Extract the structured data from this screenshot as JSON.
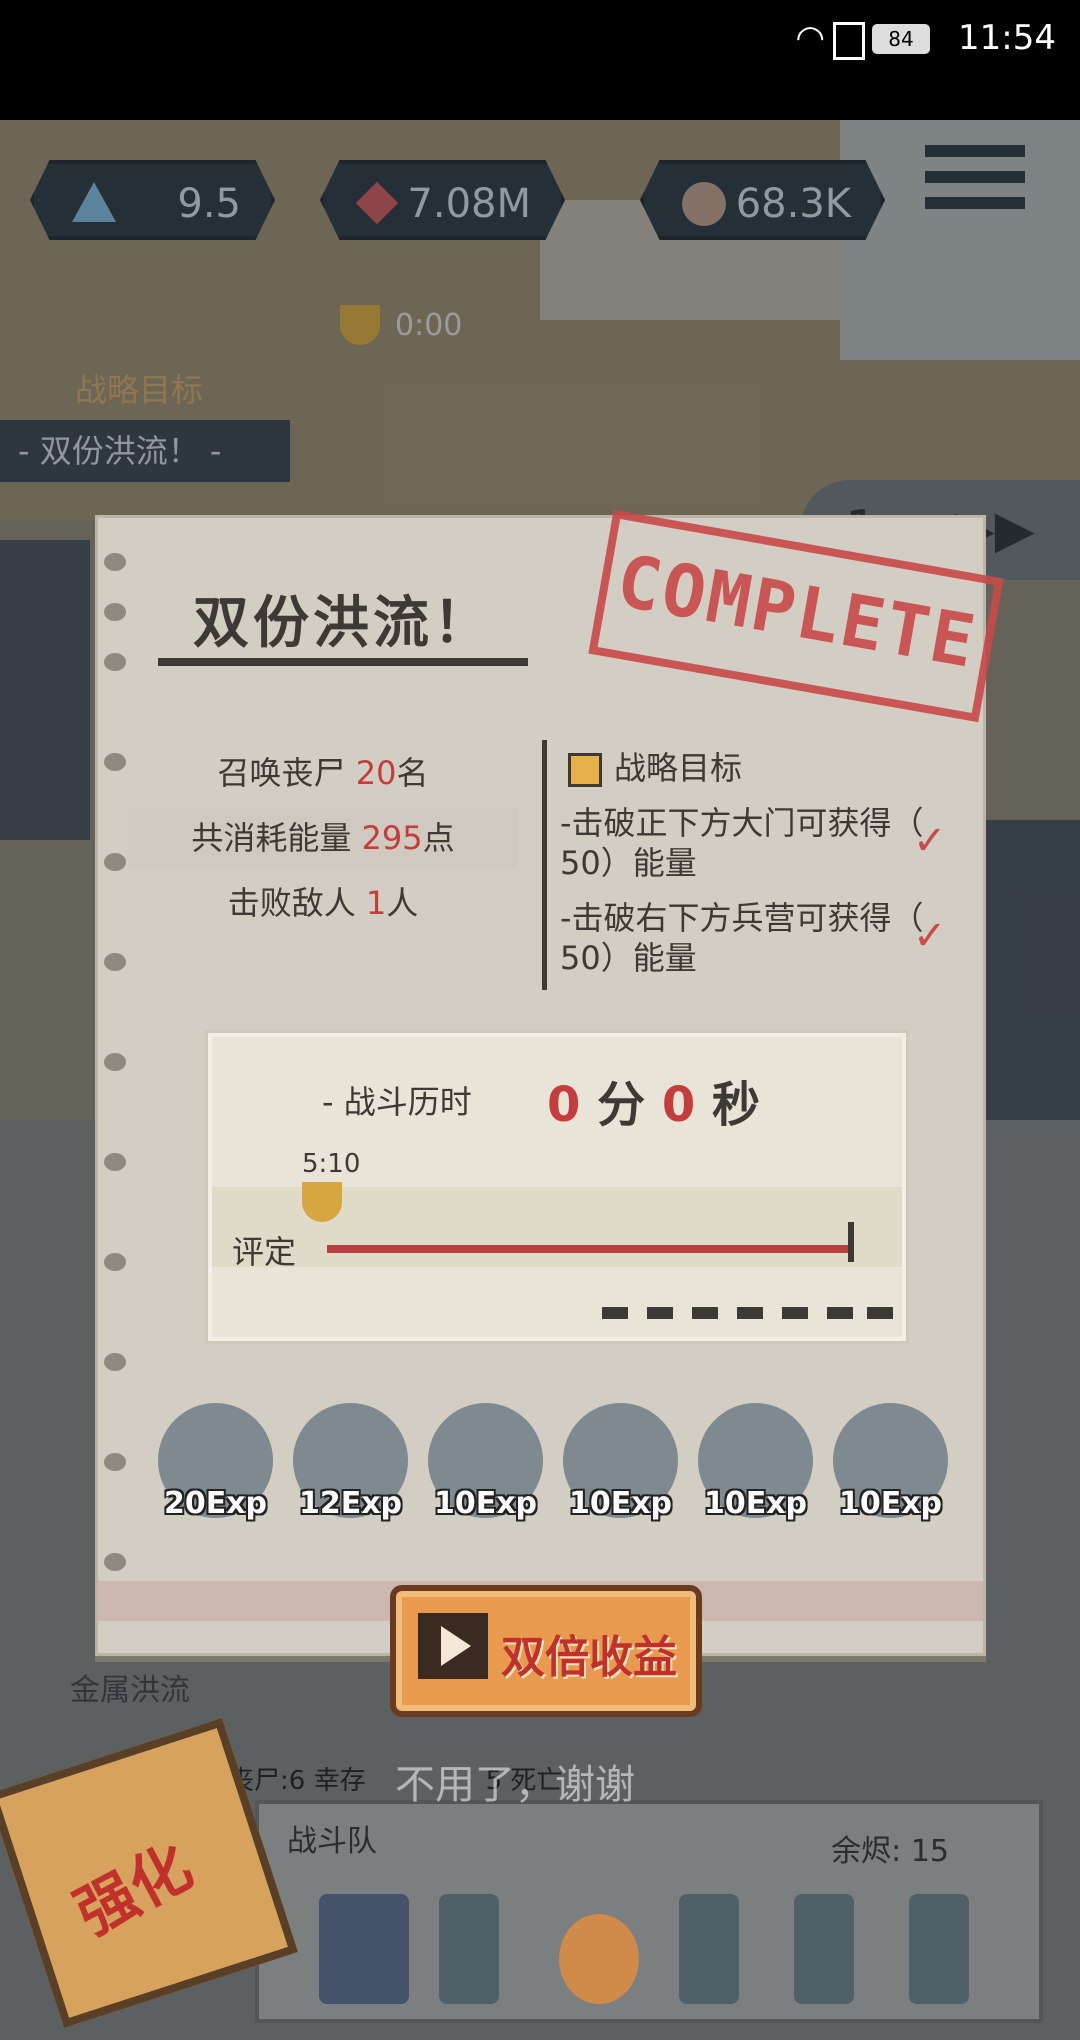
{
  "status_bar": {
    "time": "11:54",
    "battery": "84"
  },
  "hud": {
    "stat1": "9.5",
    "stat2": "7.08M",
    "stat3": "68.3K"
  },
  "level": {
    "name": "- 双份洪流！ -",
    "timer": "0:00",
    "objective_header": "战略目标",
    "speed": "1 ×"
  },
  "result": {
    "title": "双份洪流！",
    "stamp": "COMPLETE",
    "stats": [
      {
        "prefix": "召唤丧尸 ",
        "value": "20",
        "suffix": "名"
      },
      {
        "prefix": "共消耗能量 ",
        "value": "295",
        "suffix": "点"
      },
      {
        "prefix": "击败敌人 ",
        "value": "1",
        "suffix": "人"
      }
    ],
    "objectives_title": "战略目标",
    "objectives": [
      "-击破正下方大门可获得（ 50）能量",
      "-击破右下方兵营可获得（ 50）能量"
    ],
    "battle_time_label": "- 战斗历时",
    "minutes": "0",
    "minutes_unit": "分",
    "seconds": "0",
    "seconds_unit": "秒",
    "rating_label": "评定",
    "trophy_time": "5:10",
    "exp": [
      "20Exp",
      "12Exp",
      "10Exp",
      "10Exp",
      "10Exp",
      "10Exp"
    ]
  },
  "buttons": {
    "double_reward": "双倍收益",
    "no_thanks": "不用了，谢谢"
  },
  "bottom": {
    "stats": "丧尸:6   幸存",
    "stats_tail": "5  死亡",
    "team_label": "战斗队",
    "remaining": "余烬: 15",
    "enhance": "强化",
    "skill_label": "金属洪流"
  },
  "colors": {
    "accent_red": "#c43c3c",
    "paper": "#d3cec4",
    "button": "#e89a4f"
  }
}
